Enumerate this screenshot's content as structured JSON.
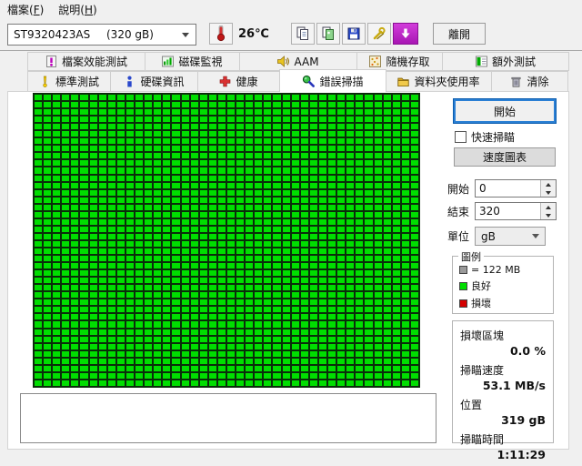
{
  "colors": {
    "good": "#00de00",
    "bad": "#d40000",
    "grid_line": "#0a2d0a",
    "legend_gray": "#9a9a9a",
    "accent_focus": "#2a7fd4"
  },
  "menu": {
    "items": [
      {
        "pre": "檔案(",
        "key": "F",
        "post": ")"
      },
      {
        "pre": "說明(",
        "key": "H",
        "post": ")"
      }
    ]
  },
  "toolbar": {
    "drive_select": {
      "name": "ST9320423AS",
      "capacity": "(320 gB)"
    },
    "temperature": "26℃",
    "icons": [
      {
        "name": "copy-icon"
      },
      {
        "name": "copy-image-icon"
      },
      {
        "name": "save-icon"
      },
      {
        "name": "tools-icon"
      },
      {
        "name": "download-icon"
      }
    ],
    "exit_label": "離開"
  },
  "tabs": {
    "row1": [
      {
        "label": "檔案效能測試",
        "icon": "file-benchmark-icon"
      },
      {
        "label": "磁碟監視",
        "icon": "disk-monitor-icon"
      },
      {
        "label": "AAM",
        "icon": "speaker-icon"
      },
      {
        "label": "隨機存取",
        "icon": "random-access-icon"
      },
      {
        "label": "額外測試",
        "icon": "extra-tests-icon"
      }
    ],
    "row2": [
      {
        "label": "標準測試",
        "icon": "exclamation-icon"
      },
      {
        "label": "硬碟資訊",
        "icon": "info-icon"
      },
      {
        "label": "健康",
        "icon": "health-cross-icon"
      },
      {
        "label": "錯誤掃描",
        "icon": "magnifier-icon",
        "active": true
      },
      {
        "label": "資料夾使用率",
        "icon": "folder-icon"
      },
      {
        "label": "清除",
        "icon": "trash-icon"
      }
    ]
  },
  "scan": {
    "start_button": "開始",
    "quick_scan_label": "快速掃瞄",
    "speed_map_label": "速度圖表",
    "start_field": {
      "label": "開始",
      "value": "0"
    },
    "end_field": {
      "label": "結束",
      "value": "320"
    },
    "unit_field": {
      "label": "單位",
      "value": "gB"
    },
    "legend": {
      "title": "圖例",
      "block_size": "= 122 MB",
      "good": "良好",
      "bad": "損壞"
    },
    "stats": [
      {
        "label": "損壞區塊",
        "value": "0.0 %"
      },
      {
        "label": "掃瞄速度",
        "value": "53.1 MB/s"
      },
      {
        "label": "位置",
        "value": "319 gB"
      },
      {
        "label": "掃瞄時間",
        "value": "1:11:29"
      }
    ]
  },
  "grid": {
    "cols": 42,
    "rows": 40,
    "bad_cells": []
  }
}
